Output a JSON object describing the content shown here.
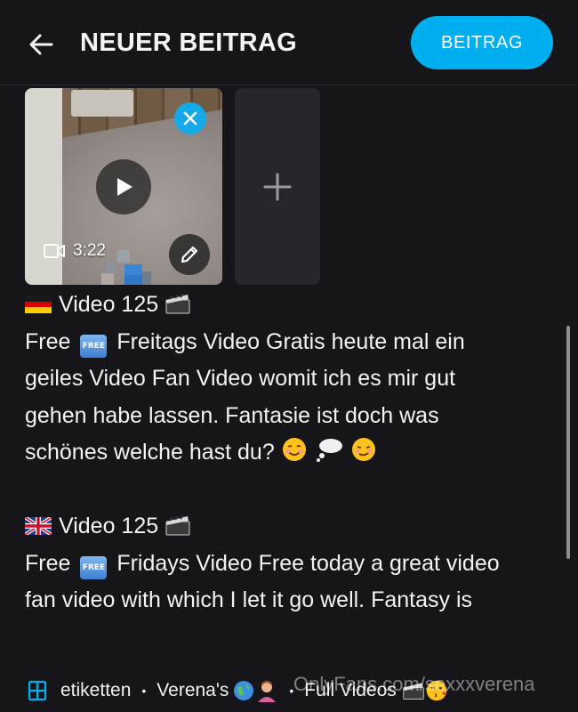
{
  "header": {
    "title": "NEUER BEITRAG",
    "post_button_label": "BEITRAG",
    "back_icon": "arrow-left-icon"
  },
  "media": {
    "duration": "3:22",
    "icons": [
      "play-icon",
      "close-icon",
      "video-camera-icon",
      "pencil-icon",
      "plus-icon"
    ]
  },
  "post": {
    "line1": "Video  125",
    "line2_a": "Free",
    "free_badge": "FREE",
    "line2_b": "Freitags Video Gratis heute mal ein",
    "line3": "geiles Video Fan Video womit ich es mir gut",
    "line4": "gehen habe lassen. Fantasie ist doch was",
    "line5": "schönes welche hast du?",
    "line7": "Video 125",
    "line8_a": "Free",
    "line8_b": "Fridays Video Free today a great video",
    "line9": "fan video with which I let it go well. Fantasy is"
  },
  "tags": {
    "label": "etiketten",
    "item1": "Verena's",
    "item2": "Full Videos",
    "watermark": "OnlyFans.com/sexxxverena"
  },
  "colors": {
    "accent": "#00aff0",
    "background": "#16161a",
    "tile": "#26272c"
  }
}
